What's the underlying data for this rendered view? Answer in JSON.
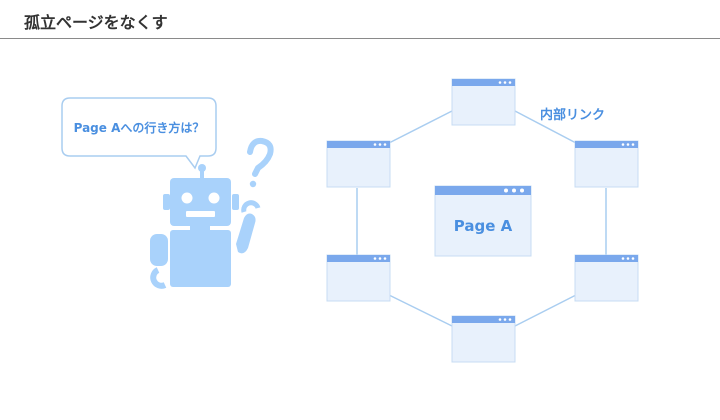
{
  "header": {
    "title": "孤立ページをなくす"
  },
  "bubble": {
    "text": "Page Aへの行き方は？"
  },
  "center_page": {
    "label": "Page A"
  },
  "link_label": "内部リンク",
  "colors": {
    "accent": "#4a8fe0",
    "page_fill": "#e8f1fc",
    "page_bar": "#7aa8ec",
    "link_line": "#a9cdf0",
    "robot": "#a9d2fb",
    "bubble_border": "#a9cdf0"
  },
  "icons": [
    "robot-icon",
    "question-mark-icon",
    "speech-bubble-icon"
  ]
}
